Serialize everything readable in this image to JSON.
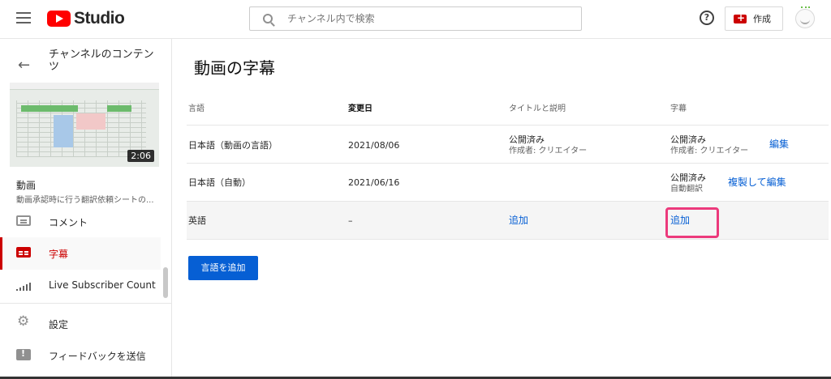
{
  "header": {
    "logo_text": "Studio",
    "search_placeholder": "チャンネル内で検索",
    "create_label": "作成"
  },
  "sidebar": {
    "back_title": "チャンネルのコンテンツ",
    "thumbnail_duration": "2:06",
    "video_label": "動画",
    "video_title": "動画承認時に行う翻訳依頼シートの...",
    "items": [
      {
        "label": "コメント",
        "icon": "comment-icon"
      },
      {
        "label": "字幕",
        "icon": "subtitles-icon",
        "active": true
      },
      {
        "label": "Live Subscriber Count",
        "icon": "signal-icon"
      }
    ],
    "footer_items": [
      {
        "label": "設定",
        "icon": "gear-icon"
      },
      {
        "label": "フィードバックを送信",
        "icon": "feedback-icon"
      }
    ]
  },
  "main": {
    "title": "動画の字幕",
    "columns": [
      "言語",
      "変更日",
      "タイトルと説明",
      "字幕"
    ],
    "rows": [
      {
        "language": "日本語（動画の言語）",
        "modified": "2021/08/06",
        "title_status": "公開済み",
        "title_author": "作成者: クリエイター",
        "subtitle_status": "公開済み",
        "subtitle_author": "作成者: クリエイター",
        "action": "編集"
      },
      {
        "language": "日本語（自動）",
        "modified": "2021/06/16",
        "subtitle_status": "公開済み",
        "subtitle_author": "自動翻訳",
        "action": "複製して編集"
      },
      {
        "language": "英語",
        "modified": "–",
        "title_action": "追加",
        "subtitle_action": "追加"
      }
    ],
    "add_language_button": "言語を追加"
  },
  "colors": {
    "accent": "#065fd4",
    "brand_red": "#cc0000",
    "highlight_box": "#ec3a7c"
  }
}
